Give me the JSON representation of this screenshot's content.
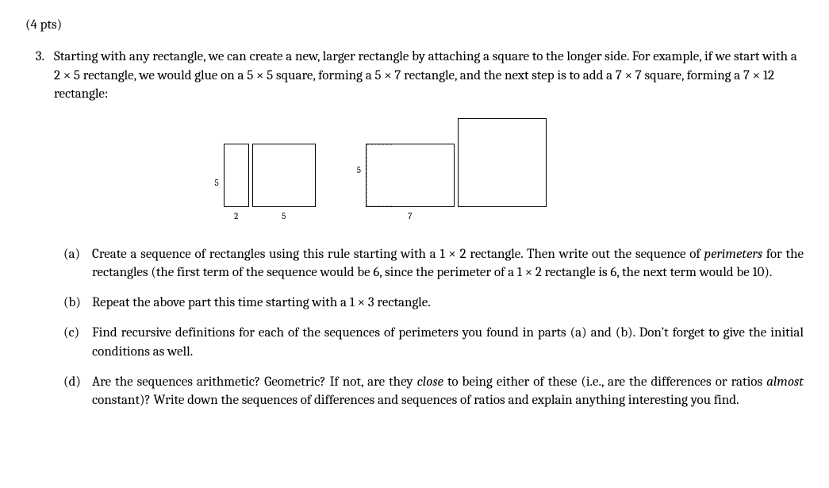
{
  "points_label": "(4 pts)",
  "problem_number": "3.",
  "stem_text": "Starting with any rectangle, we can create a new, larger rectangle by attaching a square to the longer side. For example, if we start with a 2 × 5 rectangle, we would glue on a 5 × 5 square, forming a 5 × 7 rectangle, and the next step is to add a 7 × 7 square, forming a 7 × 12 rectangle:",
  "diagram": {
    "first": {
      "side_label": "5",
      "parts": [
        {
          "w": "2"
        },
        {
          "w": "5"
        }
      ]
    },
    "second": {
      "side_label": "5",
      "bottom_label": "7"
    }
  },
  "parts": {
    "a": {
      "letter": "(a)",
      "text_before_italic": "Create a sequence of rectangles using this rule starting with a 1 × 2 rectangle. Then write out the sequence of ",
      "italic1": "perimeters",
      "text_after_italic": " for the rectangles (the first term of the sequence would be 6, since the perimeter of a 1 × 2 rectangle is 6, the next term would be 10)."
    },
    "b": {
      "letter": "(b)",
      "text": "Repeat the above part this time starting with a 1 × 3 rectangle."
    },
    "c": {
      "letter": "(c)",
      "text": "Find recursive definitions for each of the sequences of perimeters you found in parts (a) and (b). Don’t forget to give the initial conditions as well."
    },
    "d": {
      "letter": "(d)",
      "seg1": "Are the sequences arithmetic? Geometric? If not, are they ",
      "italic1": "close",
      "seg2": " to being either of these (i.e., are the differences or ratios ",
      "italic2": "almost",
      "seg3": " constant)? Write down the sequences of differences and sequences of ratios and explain anything interesting you find."
    }
  }
}
